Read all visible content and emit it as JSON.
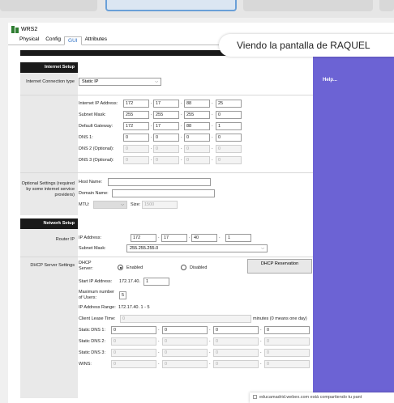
{
  "window": {
    "title": "WRS2"
  },
  "tabs": [
    "Physical",
    "Config",
    "GUI",
    "Attributes"
  ],
  "active_tab": "GUI",
  "share_banner": "Viendo la pantalla de RAQUEL",
  "help": {
    "label": "Help..."
  },
  "internet_setup": {
    "header": "Internet Setup",
    "connection_type_label": "Internet Connection type",
    "connection_type_value": "Static IP",
    "ip_label": "Internet IP Address:",
    "ip": [
      "172",
      "17",
      "88",
      "25"
    ],
    "mask_label": "Subnet Mask:",
    "mask": [
      "255",
      "255",
      "255",
      "0"
    ],
    "gw_label": "Default Gateway:",
    "gw": [
      "172",
      "17",
      "88",
      "1"
    ],
    "dns1_label": "DNS 1:",
    "dns1": [
      "0",
      "0",
      "0",
      "0"
    ],
    "dns2_label": "DNS 2 (Optional):",
    "dns2": [
      "0",
      "0",
      "0",
      "0"
    ],
    "dns3_label": "DNS 3 (Optional):",
    "dns3": [
      "0",
      "0",
      "0",
      "0"
    ]
  },
  "optional_settings": {
    "label": "Optional Settings (required by some internet service providers)",
    "host_label": "Host Name:",
    "domain_label": "Domain Name:",
    "mtu_label": "MTU:",
    "size_label": "Size:",
    "size_value": "1500"
  },
  "network_setup": {
    "header": "Network Setup",
    "router_ip_label": "Router IP",
    "ip_label": "IP Address:",
    "ip": [
      "172",
      "17",
      "40",
      "1"
    ],
    "mask_label": "Subnet Mask:",
    "mask_value": "255.255.255.0",
    "dhcp_settings_label": "DHCP Server Settings",
    "dhcp_server_label": "DHCP Server:",
    "enabled_label": "Enabled",
    "disabled_label": "Disabled",
    "dhcp_reservation_label": "DHCP Reservation",
    "start_ip_label": "Start IP Address:",
    "start_ip_prefix": "172.17.40.",
    "start_ip_last": "1",
    "max_users_label": "Maximum number of Users:",
    "max_users_value": "5",
    "range_label": "IP Address Range:",
    "range_value": "172.17.40.  1 - 5",
    "lease_label": "Client Lease Time:",
    "lease_value": "0",
    "lease_suffix": "minutes (0 means one day)",
    "sdns1_label": "Static DNS 1:",
    "sdns1": [
      "0",
      "0",
      "0",
      "0"
    ],
    "sdns2_label": "Static DNS 2:",
    "sdns2": [
      "0",
      "0",
      "0",
      "0"
    ],
    "sdns3_label": "Static DNS 3:",
    "sdns3": [
      "0",
      "0",
      "0",
      "0"
    ],
    "wins_label": "WINS:",
    "wins": [
      "0",
      "0",
      "0",
      "0"
    ]
  },
  "notice": "educamadrid.webex.com está compartiendo tu pant"
}
